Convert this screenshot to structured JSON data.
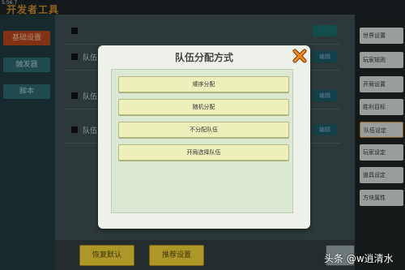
{
  "status_bar": {
    "clock": "5:56.7"
  },
  "app": {
    "title": "开发者工具"
  },
  "left_tabs": [
    {
      "label": "基础设置"
    },
    {
      "label": "触发器"
    },
    {
      "label": "脚本"
    }
  ],
  "center_rows": [
    {
      "label": "队伍",
      "button": "编辑"
    },
    {
      "label": "队伍",
      "button": "编辑"
    },
    {
      "label": "队伍",
      "button": "编辑"
    }
  ],
  "right_tabs": [
    {
      "label": "世界设置"
    },
    {
      "label": "玩家规则"
    },
    {
      "label": "开局设置"
    },
    {
      "label": "胜利目标"
    },
    {
      "label": "队伍设定"
    },
    {
      "label": "玩家设定"
    },
    {
      "label": "道具设定"
    },
    {
      "label": "方块属性"
    }
  ],
  "bottom_buttons": {
    "reset": "恢复默认",
    "recommend": "推荐设置"
  },
  "dialog": {
    "title": "队伍分配方式",
    "options": [
      "顺序分配",
      "随机分配",
      "不分配队伍",
      "开局选择队伍"
    ]
  },
  "watermark": "头条 @w逍清水",
  "colors": {
    "accent": "#b3461c",
    "option_bg": "#eef0bc",
    "button_yellow": "#f0d038",
    "close_orange": "#e87818"
  }
}
